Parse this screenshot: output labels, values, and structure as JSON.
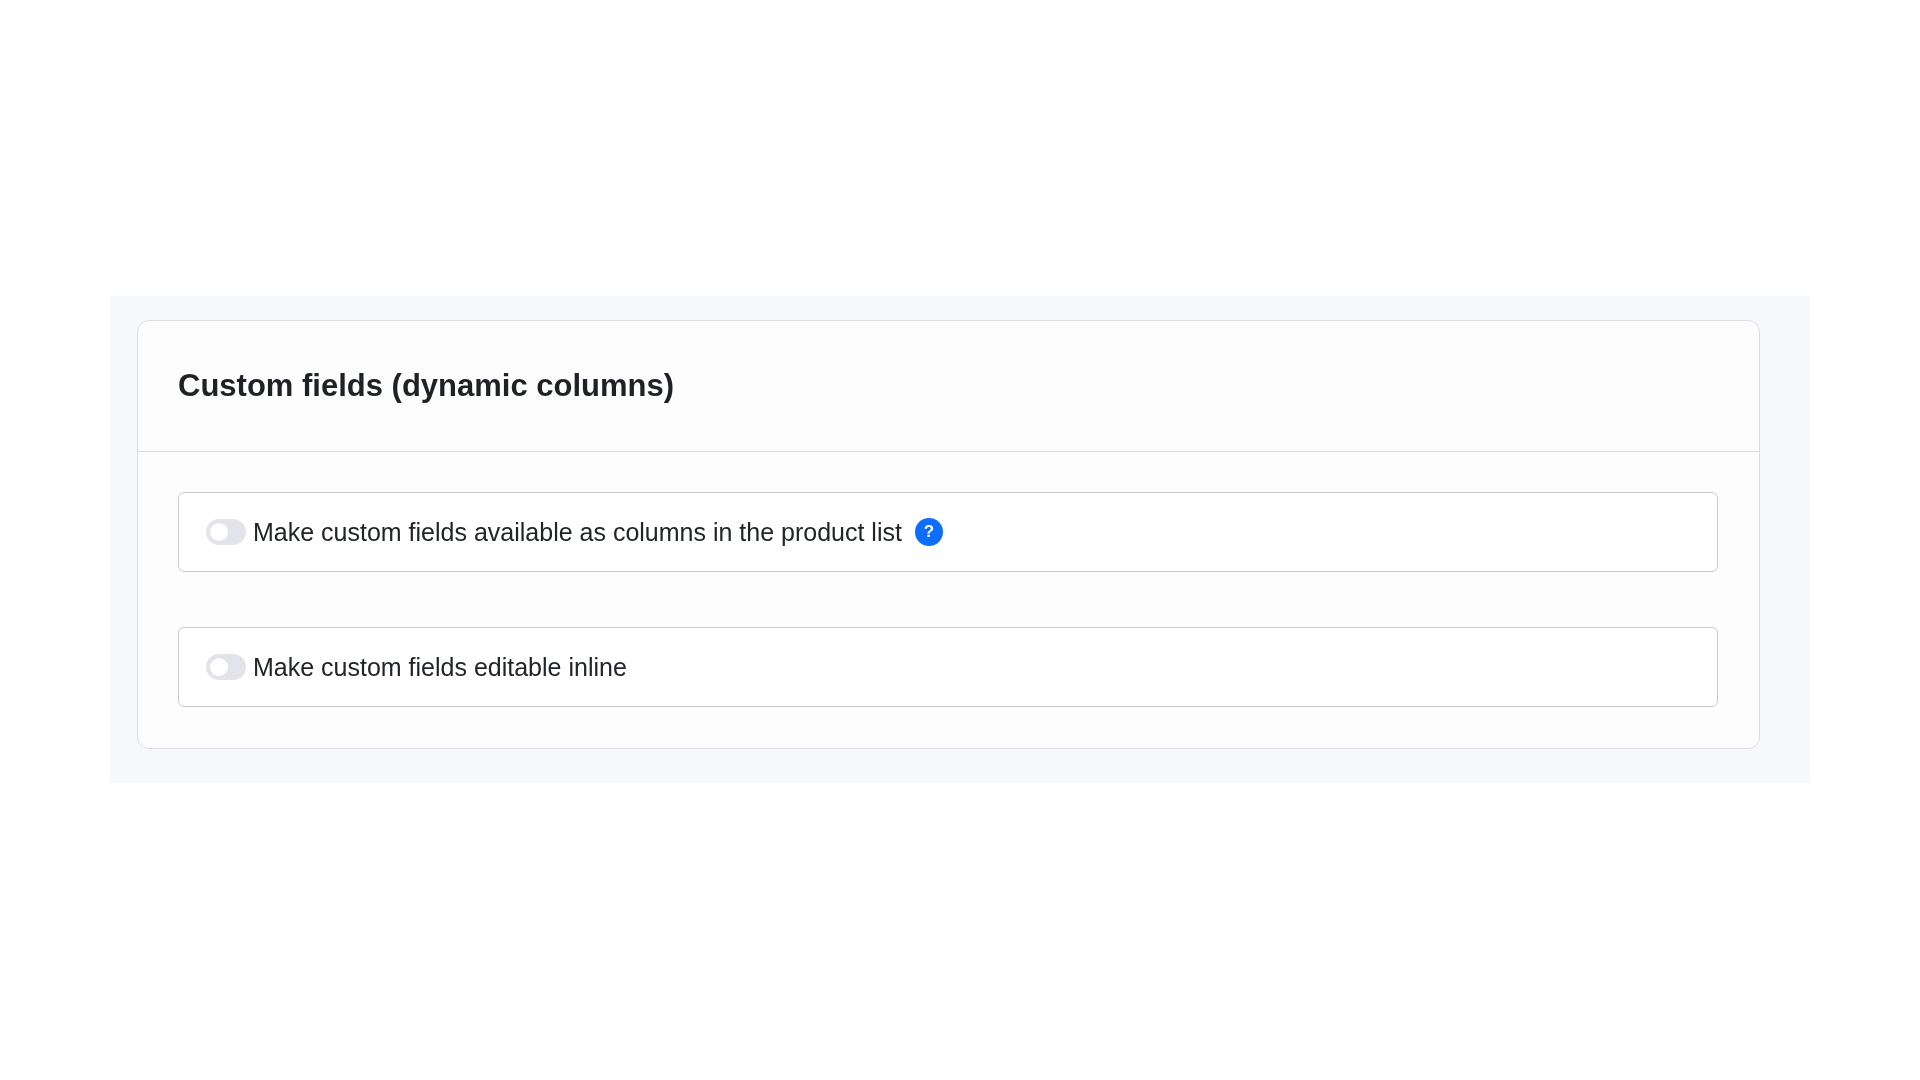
{
  "section": {
    "title": "Custom fields (dynamic columns)",
    "options": [
      {
        "label": "Make custom fields available as columns in the product list",
        "on": false,
        "help": "?"
      },
      {
        "label": "Make custom fields editable inline",
        "on": false
      }
    ]
  }
}
